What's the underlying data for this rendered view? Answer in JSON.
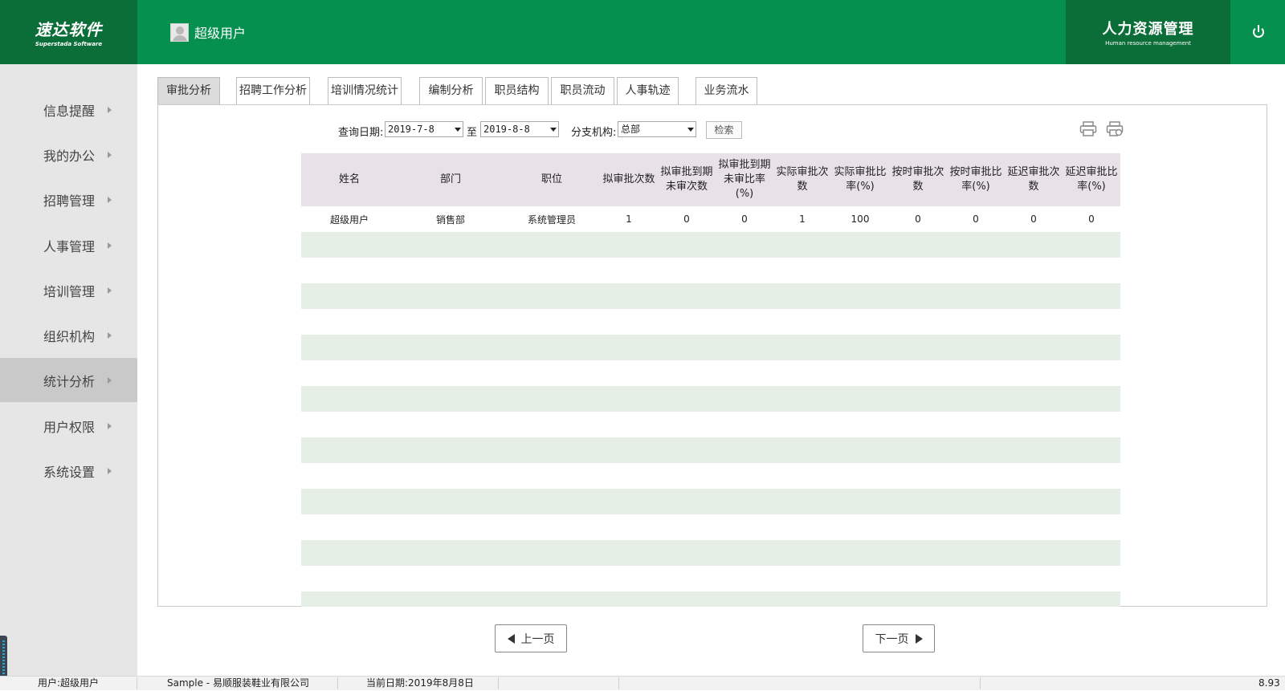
{
  "header": {
    "logo_cn": "速达软件",
    "logo_en": "Superstada Software",
    "user_name": "超级用户",
    "module_cn": "人力资源管理",
    "module_en": "Human resource management"
  },
  "sidebar": {
    "items": [
      {
        "label": "信息提醒"
      },
      {
        "label": "我的办公"
      },
      {
        "label": "招聘管理"
      },
      {
        "label": "人事管理"
      },
      {
        "label": "培训管理"
      },
      {
        "label": "组织机构"
      },
      {
        "label": "统计分析",
        "active": true
      },
      {
        "label": "用户权限"
      },
      {
        "label": "系统设置"
      }
    ]
  },
  "tabs": [
    {
      "label": "审批分析",
      "active": true
    },
    {
      "label": "招聘工作分析"
    },
    {
      "label": "培训情况统计"
    },
    {
      "label": "编制分析"
    },
    {
      "label": "职员结构"
    },
    {
      "label": "职员流动"
    },
    {
      "label": "人事轨迹"
    },
    {
      "label": "业务流水"
    }
  ],
  "query": {
    "date_label": "查询日期:",
    "date_from": "2019-7-8",
    "to_label": "至",
    "date_to": "2019-8-8",
    "branch_label": "分支机构:",
    "branch_value": "总部",
    "search_label": "检索"
  },
  "table": {
    "headers": [
      "姓名",
      "部门",
      "职位",
      "拟审批次数",
      "拟审批到期未审次数",
      "拟审批到期未审比率(%)",
      "实际审批次数",
      "实际审批比率(%)",
      "按时审批次数",
      "按时审批比率(%)",
      "延迟审批次数",
      "延迟审批比率(%)"
    ],
    "rows": [
      [
        "超级用户",
        "销售部",
        "系统管理员",
        "1",
        "0",
        "0",
        "1",
        "100",
        "0",
        "0",
        "0",
        "0"
      ]
    ]
  },
  "pager": {
    "prev_label": "上一页",
    "next_label": "下一页"
  },
  "status": {
    "user": "用户:超级用户",
    "company": "Sample - 易顺服装鞋业有限公司",
    "date": "当前日期:2019年8月8日",
    "version": "8.93"
  }
}
